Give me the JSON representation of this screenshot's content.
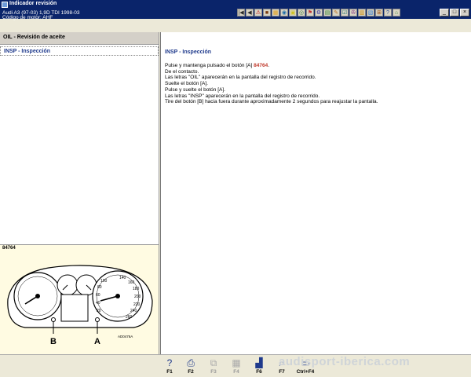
{
  "window": {
    "title": "Indicador revisión",
    "vehicle_line": "Audi   A3 (97-03) 1,9D TDI 1998-03",
    "engine_line": "Código de motor: AHF",
    "minimize": "_",
    "maximize": "□",
    "close": "×"
  },
  "toolbar": {
    "buttons": [
      "|◀",
      "◀",
      "⚠",
      "■",
      "▦",
      "◉",
      "▣",
      "◎",
      "⚑",
      "⚙",
      "▤",
      "✎",
      "☑",
      "✇",
      "▥",
      "▧",
      "⊞",
      "?",
      "⌂"
    ],
    "colors": [
      "#2a2a2a",
      "#2a2a2a",
      "#c00000",
      "#7a3b10",
      "#e0a020",
      "#1c6ca8",
      "#d0c020",
      "#3a7a3a",
      "#c03030",
      "#2f2f9f",
      "#2f7f2f",
      "#c07020",
      "#207070",
      "#7f2f7f",
      "#cc8800",
      "#3377cc",
      "#994400",
      "#2a4a9a",
      "#448844"
    ]
  },
  "left_panel": {
    "section_header": "OIL - Revisión de aceite",
    "items": [
      {
        "label": "INSP - Inspección",
        "selected": true
      }
    ]
  },
  "right_panel": {
    "title": "INSP - Inspección",
    "instruction_prefix": "Pulse y mantenga pulsado el botón [A] ",
    "instruction_ref": "84764",
    "instruction_suffix": ".",
    "lines": [
      "De el contacto.",
      "Las letras \"OIL\" aparecerán en la pantalla del registro de recorrido.",
      "Suelte el botón [A].",
      "Pulse y suelte el botón [A].",
      "Las letras \"INSP\" aparecerán en la pantalla del registro de recorrido.",
      "Tire del botón [B] hacia fuera durante aproximadamente 2 segundos para reajustar la pantalla."
    ]
  },
  "image_panel": {
    "reference": "84764",
    "label_b": "B",
    "label_a": "A",
    "figure_code": "AD0476A",
    "dial_labels": [
      "100",
      "80",
      "60",
      "40",
      "20",
      "140",
      "160",
      "180",
      "200",
      "220",
      "240",
      "260"
    ]
  },
  "function_keys": [
    {
      "label": "F1",
      "icon": "help-icon",
      "glyph": "?",
      "enabled": true
    },
    {
      "label": "F2",
      "icon": "print-icon",
      "glyph": "⎙",
      "enabled": true
    },
    {
      "label": "F3",
      "icon": "copy-icon",
      "glyph": "⧉",
      "enabled": false
    },
    {
      "label": "F4",
      "icon": "grid-icon",
      "glyph": "▦",
      "enabled": false
    },
    {
      "label": "F6",
      "icon": "graph-icon",
      "glyph": "▟",
      "enabled": true
    },
    {
      "label": "F7",
      "icon": "zoom-icon",
      "glyph": "⌕",
      "enabled": true
    },
    {
      "label": "Ctrl+F4",
      "icon": "close-window-icon",
      "glyph": "▭",
      "enabled": true
    }
  ],
  "watermark": "audisport-iberica.com"
}
